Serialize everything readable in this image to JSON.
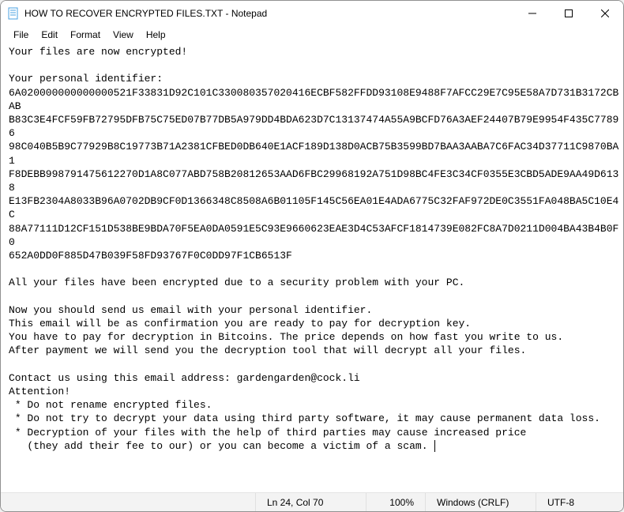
{
  "titlebar": {
    "title": "HOW TO RECOVER ENCRYPTED FILES.TXT - Notepad"
  },
  "menubar": {
    "items": [
      "File",
      "Edit",
      "Format",
      "View",
      "Help"
    ]
  },
  "content": {
    "text": "Your files are now encrypted!\n\nYour personal identifier:\n6A020000000000000521F33831D92C101C330080357020416ECBF582FFDD93108E9488F7AFCC29E7C95E58A7D731B3172CBAB\nB83C3E4FCF59FB72795DFB75C75ED07B77DB5A979DD4BDA623D7C13137474A55A9BCFD76A3AEF24407B79E9954F435C77896\n98C040B5B9C77929B8C19773B71A2381CFBED0DB640E1ACF189D138D0ACB75B3599BD7BAA3AABA7C6FAC34D37711C9870BA1\nF8DEBB998791475612270D1A8C077ABD758B20812653AAD6FBC29968192A751D98BC4FE3C34CF0355E3CBD5ADE9AA49D6138\nE13FB2304A8033B96A0702DB9CF0D1366348C8508A6B01105F145C56EA01E4ADA6775C32FAF972DE0C3551FA048BA5C10E4C\n88A77111D12CF151D538BE9BDA70F5EA0DA0591E5C93E9660623EAE3D4C53AFCF1814739E082FC8A7D0211D004BA43B4B0F0\n652A0DD0F885D47B039F58FD93767F0C0DD97F1CB6513F\n\nAll your files have been encrypted due to a security problem with your PC.\n\nNow you should send us email with your personal identifier.\nThis email will be as confirmation you are ready to pay for decryption key.\nYou have to pay for decryption in Bitcoins. The price depends on how fast you write to us.\nAfter payment we will send you the decryption tool that will decrypt all your files.\n\nContact us using this email address: gardengarden@cock.li\nAttention!\n * Do not rename encrypted files.\n * Do not try to decrypt your data using third party software, it may cause permanent data loss.\n * Decryption of your files with the help of third parties may cause increased price\n   (they add their fee to our) or you can become a victim of a scam. "
  },
  "statusbar": {
    "position": "Ln 24, Col 70",
    "zoom": "100%",
    "line_ending": "Windows (CRLF)",
    "encoding": "UTF-8"
  }
}
